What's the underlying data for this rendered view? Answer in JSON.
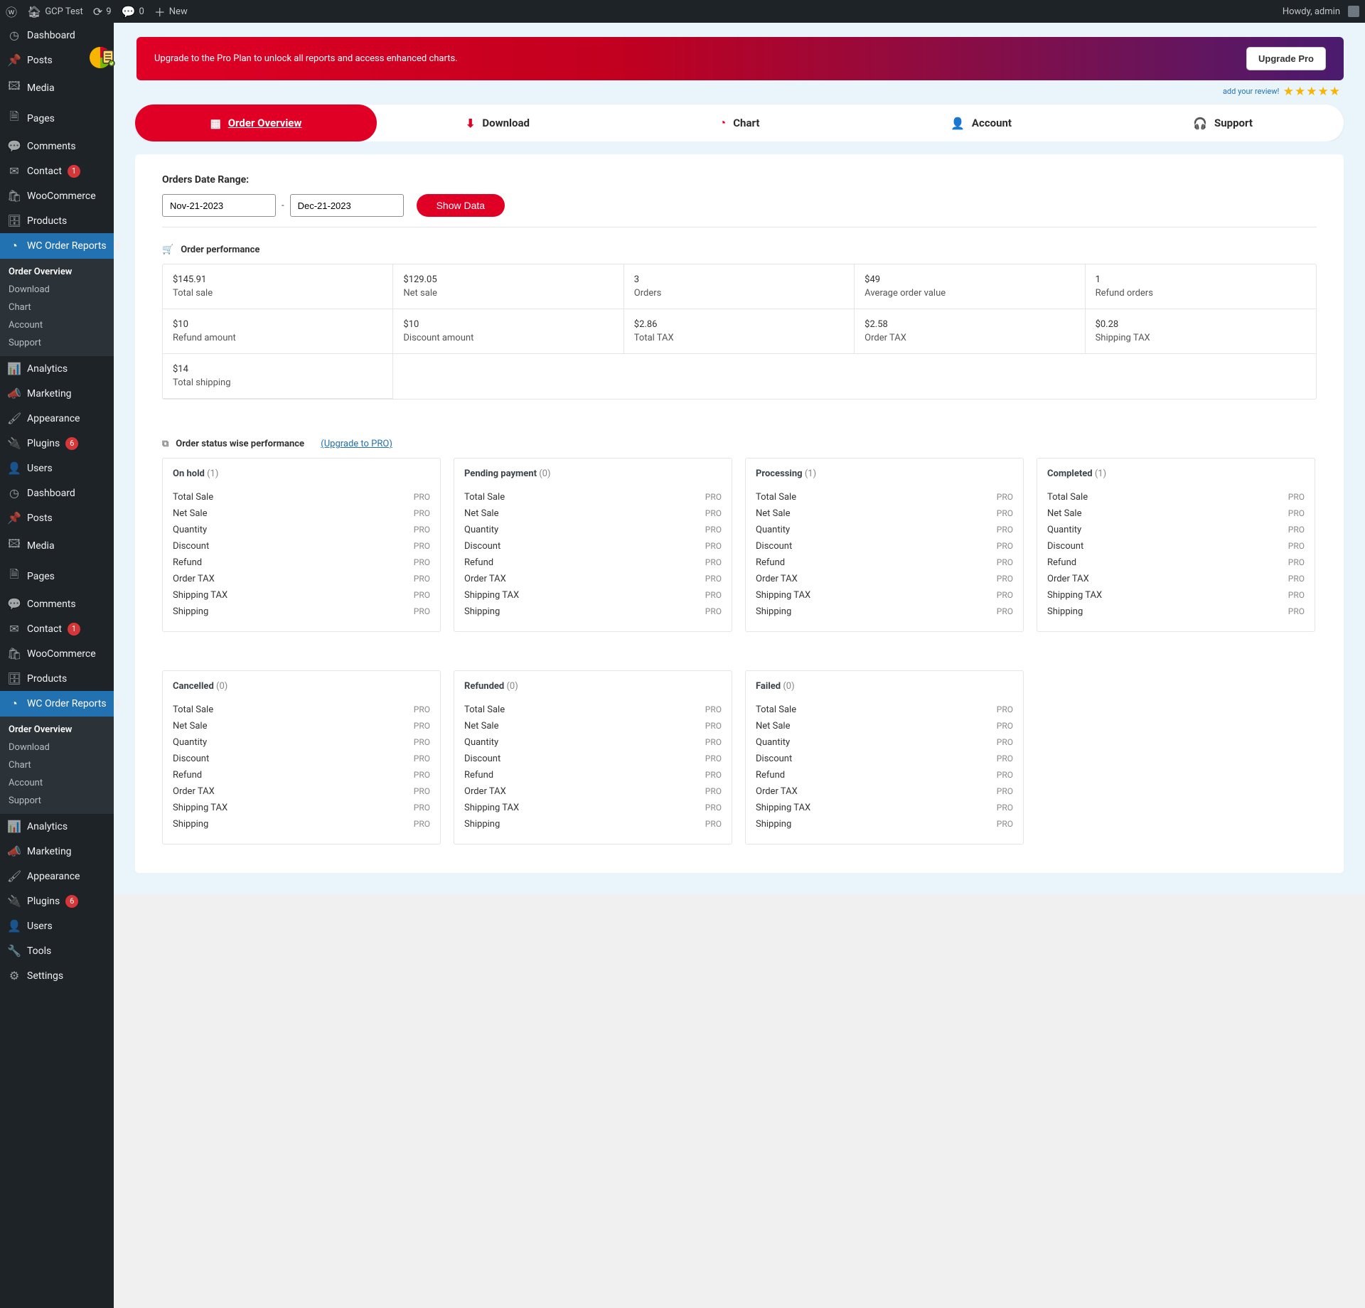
{
  "adminbar": {
    "site_name": "GCP Test",
    "updates": "9",
    "comments": "0",
    "new": "New",
    "howdy": "Howdy, admin"
  },
  "sidebar": {
    "items": [
      {
        "label": "Dashboard",
        "icon": "◷"
      },
      {
        "label": "Posts",
        "icon": "📌"
      },
      {
        "label": "Media",
        "icon": "🖾"
      },
      {
        "label": "Pages",
        "icon": "🗎"
      },
      {
        "label": "Comments",
        "icon": "💬"
      },
      {
        "label": "Contact",
        "icon": "✉",
        "badge": "1"
      },
      {
        "label": "WooCommerce",
        "icon": "🛍"
      },
      {
        "label": "Products",
        "icon": "🗄"
      },
      {
        "label": "WC Order Reports",
        "icon": "◔",
        "current": true
      },
      {
        "label": "Analytics",
        "icon": "📊"
      },
      {
        "label": "Marketing",
        "icon": "📣"
      },
      {
        "label": "Appearance",
        "icon": "🖌"
      },
      {
        "label": "Plugins",
        "icon": "🔌",
        "badge": "6"
      },
      {
        "label": "Users",
        "icon": "👤"
      },
      {
        "label": "Dashboard",
        "icon": "◷"
      },
      {
        "label": "Posts",
        "icon": "📌"
      },
      {
        "label": "Media",
        "icon": "🖾"
      },
      {
        "label": "Pages",
        "icon": "🗎"
      },
      {
        "label": "Comments",
        "icon": "💬"
      },
      {
        "label": "Contact",
        "icon": "✉",
        "badge": "1"
      },
      {
        "label": "WooCommerce",
        "icon": "🛍"
      },
      {
        "label": "Products",
        "icon": "🗄"
      },
      {
        "label": "WC Order Reports",
        "icon": "◔",
        "current": true
      },
      {
        "label": "Analytics",
        "icon": "📊"
      },
      {
        "label": "Marketing",
        "icon": "📣"
      },
      {
        "label": "Appearance",
        "icon": "🖌"
      },
      {
        "label": "Plugins",
        "icon": "🔌",
        "badge": "6"
      },
      {
        "label": "Users",
        "icon": "👤"
      },
      {
        "label": "Tools",
        "icon": "🔧"
      },
      {
        "label": "Settings",
        "icon": "⚙"
      }
    ],
    "submenu": [
      "Order Overview",
      "Download",
      "Chart",
      "Account",
      "Support"
    ]
  },
  "banner": {
    "text": "Upgrade to the Pro Plan to unlock all reports and access enhanced charts.",
    "button": "Upgrade Pro",
    "review": "add your review!"
  },
  "tabs": [
    {
      "label": "Order Overview",
      "icon": "▦",
      "active": true
    },
    {
      "label": "Download",
      "icon": "⬇"
    },
    {
      "label": "Chart",
      "icon": "◔"
    },
    {
      "label": "Account",
      "icon": "👤"
    },
    {
      "label": "Support",
      "icon": "🎧"
    }
  ],
  "range": {
    "label": "Orders Date Range:",
    "from": "Nov-21-2023",
    "to": "Dec-21-2023",
    "button": "Show Data"
  },
  "performance": {
    "title": "Order performance",
    "kpis": [
      {
        "val": "$145.91",
        "lbl": "Total sale"
      },
      {
        "val": "$129.05",
        "lbl": "Net sale"
      },
      {
        "val": "3",
        "lbl": "Orders"
      },
      {
        "val": "$49",
        "lbl": "Average order value"
      },
      {
        "val": "1",
        "lbl": "Refund orders"
      },
      {
        "val": "$10",
        "lbl": "Refund amount"
      },
      {
        "val": "$10",
        "lbl": "Discount amount"
      },
      {
        "val": "$2.86",
        "lbl": "Total TAX"
      },
      {
        "val": "$2.58",
        "lbl": "Order TAX"
      },
      {
        "val": "$0.28",
        "lbl": "Shipping TAX"
      },
      {
        "val": "$14",
        "lbl": "Total shipping"
      }
    ]
  },
  "status_section": {
    "title": "Order status wise performance",
    "upgrade": "(Upgrade to PRO)",
    "row_keys": [
      "Total Sale",
      "Net Sale",
      "Quantity",
      "Discount",
      "Refund",
      "Order TAX",
      "Shipping TAX",
      "Shipping"
    ],
    "pro_label": "PRO",
    "statuses": [
      {
        "name": "On hold",
        "count": "1"
      },
      {
        "name": "Pending payment",
        "count": "0"
      },
      {
        "name": "Processing",
        "count": "1"
      },
      {
        "name": "Completed",
        "count": "1"
      },
      {
        "name": "Cancelled",
        "count": "0"
      },
      {
        "name": "Refunded",
        "count": "0"
      },
      {
        "name": "Failed",
        "count": "0"
      }
    ]
  }
}
